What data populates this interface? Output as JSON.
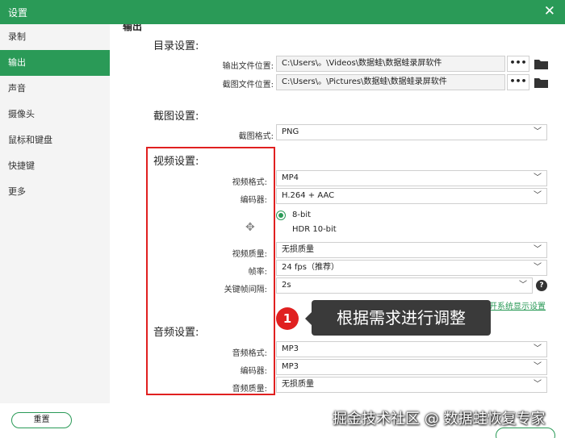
{
  "window": {
    "title": "设置",
    "close": "✕"
  },
  "sidebar": {
    "items": [
      {
        "label": "录制"
      },
      {
        "label": "输出"
      },
      {
        "label": "声音"
      },
      {
        "label": "摄像头"
      },
      {
        "label": "鼠标和键盘"
      },
      {
        "label": "快捷键"
      },
      {
        "label": "更多"
      }
    ],
    "active_index": 1
  },
  "output": {
    "section_title": "输出",
    "directory": {
      "title": "目录设置:",
      "output_label": "输出文件位置:",
      "output_path": "C:\\Users\\。\\Videos\\数据蛙\\数据蛙录屏软件",
      "screenshot_label": "截图文件位置:",
      "screenshot_path": "C:\\Users\\。\\Pictures\\数据蛙\\数据蛙录屏软件",
      "browse": "•••"
    },
    "screenshot": {
      "title": "截图设置:",
      "format_label": "截图格式:",
      "format_value": "PNG"
    },
    "video": {
      "title": "视频设置:",
      "format_label": "视频格式:",
      "format_value": "MP4",
      "encoder_label": "编码器:",
      "encoder_value": "H.264 + AAC",
      "bit_8": "8-bit",
      "bit_hdr": "HDR 10-bit",
      "quality_label": "视频质量:",
      "quality_value": "无损质量",
      "fps_label": "帧率:",
      "fps_value": "24 fps（推荐）",
      "keyframe_label": "关键帧间隔:",
      "keyframe_value": "2s",
      "help": "?",
      "system_link": "打开系统显示设置"
    },
    "audio": {
      "title": "音频设置:",
      "format_label": "音频格式:",
      "format_value": "MP3",
      "encoder_label": "编码器:",
      "encoder_value": "MP3",
      "quality_label": "音频质量:",
      "quality_value": "无损质量"
    }
  },
  "annotation": {
    "number": "1",
    "text": "根据需求进行调整"
  },
  "footer": {
    "reset": "重置",
    "watermark": "掘金技术社区 @ 数据蛙恢复专家"
  },
  "colors": {
    "accent": "#2a9a57",
    "highlight": "#e02020"
  },
  "icons": {
    "chevron": "chevron-down-icon",
    "folder": "folder-icon",
    "move": "move-icon",
    "help": "help-icon"
  }
}
